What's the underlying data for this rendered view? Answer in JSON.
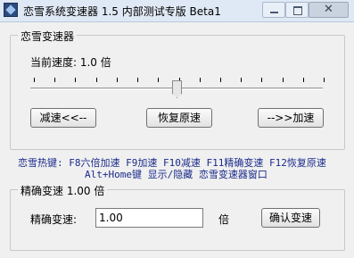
{
  "window": {
    "title": "恋雪系统变速器 1.5 内部测试专版 Beta1",
    "close_glyph": "✕"
  },
  "speed_group": {
    "title": "恋雪变速器",
    "current_speed_label": "当前速度: 1.0 倍",
    "slider_level": 0.5,
    "tick_count": 15,
    "slow_button": "减速<<--",
    "reset_button": "恢复原速",
    "fast_button": "-->>加速"
  },
  "hotkeys": {
    "line1": "恋雪热键: F8六倍加速 F9加速 F10减速 F11精确变速 F12恢复原速",
    "line2": "Alt+Home键 显示/隐藏 恋雪变速器窗口",
    "color": "#1a2a8a"
  },
  "precise_group": {
    "title": "精确变速 1.00 倍",
    "field_label": "精确变速:",
    "input_value": "1.00",
    "unit": "倍",
    "confirm_button": "确认变速"
  }
}
